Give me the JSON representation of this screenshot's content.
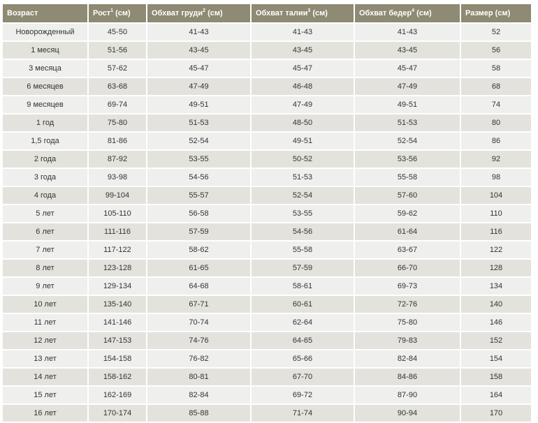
{
  "table": {
    "headers": [
      {
        "text": "Возраст",
        "sup": ""
      },
      {
        "text": "Рост",
        "sup": "1",
        "unit": " (см)"
      },
      {
        "text": "Обхват груди",
        "sup": "2",
        "unit": " (см)"
      },
      {
        "text": "Обхват талии",
        "sup": "3",
        "unit": " (см)"
      },
      {
        "text": "Обхват бедер",
        "sup": "4",
        "unit": " (см)"
      },
      {
        "text": "Размер (см)",
        "sup": ""
      }
    ],
    "rows": [
      [
        "Новорожденный",
        "45-50",
        "41-43",
        "41-43",
        "41-43",
        "52"
      ],
      [
        "1 месяц",
        "51-56",
        "43-45",
        "43-45",
        "43-45",
        "56"
      ],
      [
        "3 месяца",
        "57-62",
        "45-47",
        "45-47",
        "45-47",
        "58"
      ],
      [
        "6 месяцев",
        "63-68",
        "47-49",
        "46-48",
        "47-49",
        "68"
      ],
      [
        "9 месяцев",
        "69-74",
        "49-51",
        "47-49",
        "49-51",
        "74"
      ],
      [
        "1 год",
        "75-80",
        "51-53",
        "48-50",
        "51-53",
        "80"
      ],
      [
        "1,5 года",
        "81-86",
        "52-54",
        "49-51",
        "52-54",
        "86"
      ],
      [
        "2 года",
        "87-92",
        "53-55",
        "50-52",
        "53-56",
        "92"
      ],
      [
        "3 года",
        "93-98",
        "54-56",
        "51-53",
        "55-58",
        "98"
      ],
      [
        "4 года",
        "99-104",
        "55-57",
        "52-54",
        "57-60",
        "104"
      ],
      [
        "5 лет",
        "105-110",
        "56-58",
        "53-55",
        "59-62",
        "110"
      ],
      [
        "6 лет",
        "111-116",
        "57-59",
        "54-56",
        "61-64",
        "116"
      ],
      [
        "7 лет",
        "117-122",
        "58-62",
        "55-58",
        "63-67",
        "122"
      ],
      [
        "8 лет",
        "123-128",
        "61-65",
        "57-59",
        "66-70",
        "128"
      ],
      [
        "9 лет",
        "129-134",
        "64-68",
        "58-61",
        "69-73",
        "134"
      ],
      [
        "10 лет",
        "135-140",
        "67-71",
        "60-61",
        "72-76",
        "140"
      ],
      [
        "11 лет",
        "141-146",
        "70-74",
        "62-64",
        "75-80",
        "146"
      ],
      [
        "12 лет",
        "147-153",
        "74-76",
        "64-65",
        "79-83",
        "152"
      ],
      [
        "13 лет",
        "154-158",
        "76-82",
        "65-66",
        "82-84",
        "154"
      ],
      [
        "14 лет",
        "158-162",
        "80-81",
        "67-70",
        "84-86",
        "158"
      ],
      [
        "15 лет",
        "162-169",
        "82-84",
        "69-72",
        "87-90",
        "164"
      ],
      [
        "16 лет",
        "170-174",
        "85-88",
        "71-74",
        "90-94",
        "170"
      ]
    ]
  },
  "colors": {
    "header_bg": "#8e8a73",
    "header_text": "#ffffff",
    "row_odd": "#efefee",
    "row_even": "#e3e2dc"
  }
}
